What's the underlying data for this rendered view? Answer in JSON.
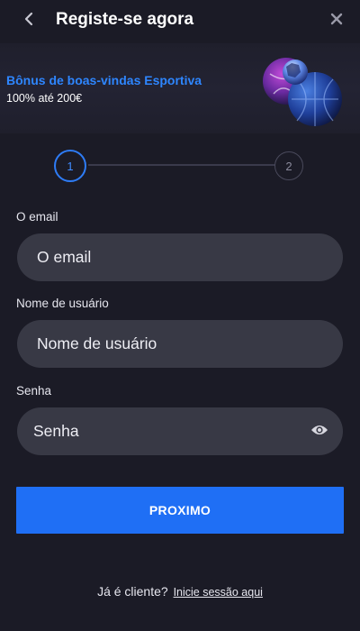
{
  "header": {
    "title": "Registe-se agora",
    "back_icon": "chevron-left-icon",
    "close_icon": "close-icon"
  },
  "banner": {
    "title": "Bônus de boas-vindas Esportiva",
    "subtitle": "100% até 200€",
    "accent_color": "#2e86ff"
  },
  "stepper": {
    "steps": [
      "1",
      "2"
    ],
    "active_step": 1,
    "active_color": "#2e7cf6"
  },
  "form": {
    "email": {
      "label": "O email",
      "placeholder": "O email",
      "value": ""
    },
    "username": {
      "label": "Nome de usuário",
      "placeholder": "Nome de usuário",
      "value": ""
    },
    "password": {
      "label": "Senha",
      "placeholder": "Senha",
      "value": "",
      "toggle_icon": "eye-icon"
    },
    "submit_label": "PROXIMO",
    "submit_color": "#1f6ff5"
  },
  "footer": {
    "prompt": "Já é cliente?",
    "link_label": "Inicie sessão aqui"
  }
}
